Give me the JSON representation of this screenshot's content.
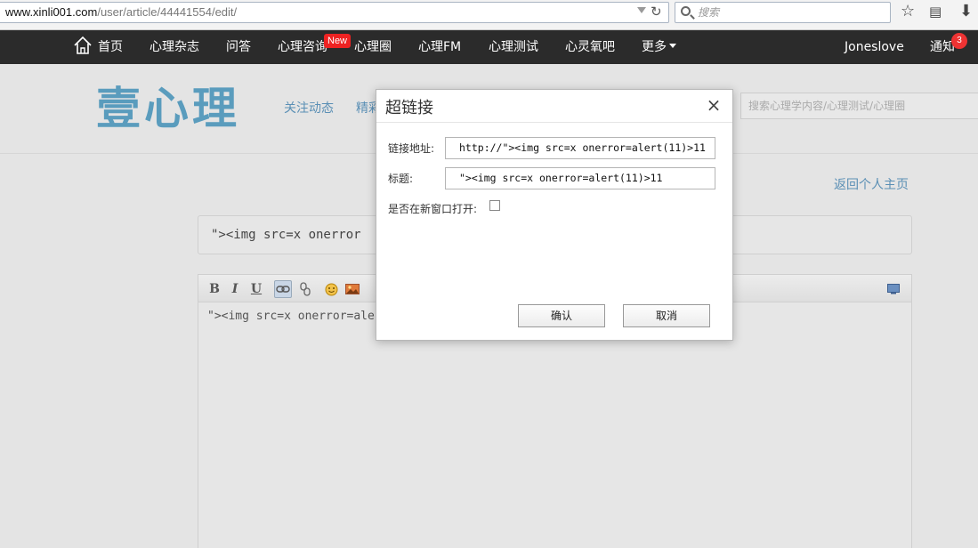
{
  "browser": {
    "url_host": "www.xinli001.com",
    "url_path": "/user/article/44441554/edit/",
    "search_placeholder": "搜索"
  },
  "nav": {
    "items": [
      {
        "label": "首页"
      },
      {
        "label": "心理杂志"
      },
      {
        "label": "问答"
      },
      {
        "label": "心理咨询"
      },
      {
        "label": "心理圈"
      },
      {
        "label": "心理FM"
      },
      {
        "label": "心理测试"
      },
      {
        "label": "心灵氧吧"
      },
      {
        "label": "更多"
      }
    ],
    "new_badge": "New",
    "username": "Joneslove",
    "notice_label": "通知",
    "notice_count": "3"
  },
  "header": {
    "logo": "壹心理",
    "subnav": [
      "关注动态",
      "精彩"
    ],
    "search_placeholder": "搜索心理学内容/心理测试/心理圈",
    "back_link": "返回个人主页"
  },
  "editor": {
    "title_value": "\"><img src=x onerror",
    "body_text": "\"><img src=x onerror=ale",
    "toolbar": {
      "bold": "B",
      "italic": "I",
      "underline": "U"
    }
  },
  "dialog": {
    "title": "超链接",
    "close_glyph": "×",
    "url_label": "链接地址:",
    "url_value": "http://\"><img src=x onerror=alert(11)>11",
    "title_label": "标题:",
    "title_value": "\"><img src=x onerror=alert(11)>11",
    "newwin_label": "是否在新窗口打开:",
    "newwin_checked": false,
    "confirm_label": "确认",
    "cancel_label": "取消"
  },
  "colors": {
    "nav_bg": "#2b2b2b",
    "logo": "#5a9cbd",
    "link": "#5a8fb5",
    "badge": "#e22222"
  }
}
